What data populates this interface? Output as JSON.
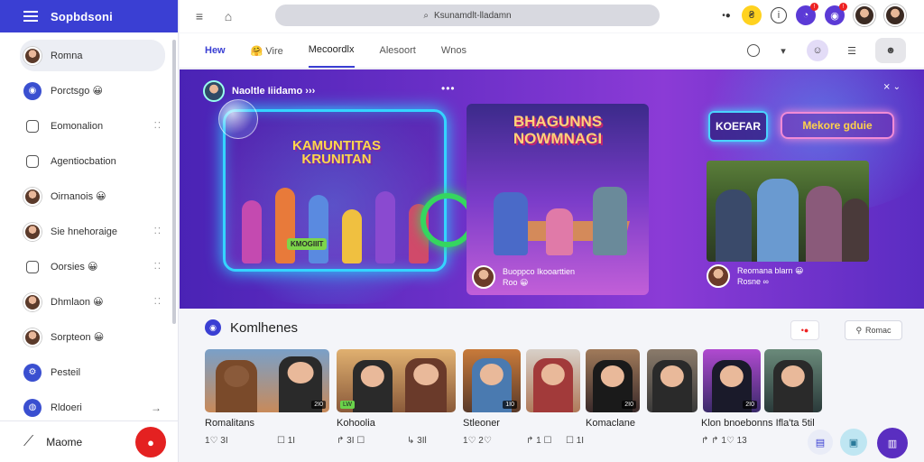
{
  "app": {
    "title": "Sopbdsoni",
    "brand_color": "#3a3fd3"
  },
  "sidebar": {
    "items": [
      {
        "label": "Romna",
        "icon": "avatar",
        "active": true
      },
      {
        "label": "Porctsgo 😀",
        "icon": "app-icon"
      },
      {
        "label": "Eomonalion",
        "icon": "list-icon",
        "more": "⁚⁚"
      },
      {
        "label": "Agentiocbation",
        "icon": "chat-icon"
      },
      {
        "label": "Oirnanois 😀",
        "icon": "avatar"
      },
      {
        "label": "Sie hnehoraige",
        "icon": "avatar",
        "more": "⁚⁚"
      },
      {
        "label": "Oorsies 😀",
        "icon": "doc-icon",
        "more": "⁚⁚"
      },
      {
        "label": "Dhmlaon 😀",
        "icon": "avatar",
        "more": "⁚⁚"
      },
      {
        "label": "Sorpteon 😀",
        "icon": "avatar"
      },
      {
        "label": "Pesteil",
        "icon": "settings-icon"
      },
      {
        "label": "Rldoeri",
        "icon": "globe-icon",
        "arrow": "→"
      }
    ],
    "footer": {
      "label": "Maome",
      "record_icon": "record-icon"
    }
  },
  "topbar": {
    "search_placeholder": "Ksunamdlt-lladamn",
    "icons": [
      "menu-icon",
      "home-icon",
      "dots-icon",
      "yellow-badge-icon",
      "info-icon",
      "notifications-icon",
      "alert-icon"
    ]
  },
  "tabs": {
    "items": [
      {
        "label": "Hew",
        "brand": true
      },
      {
        "label": "🤗 Vire"
      },
      {
        "label": "Mecoordlx",
        "active": true
      },
      {
        "label": "Alesoort"
      },
      {
        "label": "Wnos"
      }
    ]
  },
  "hero": {
    "channel": "Naoltle Iiidamo ›››",
    "more": "•••",
    "controls": "⨯ ⌄",
    "left_title": "KAMUNTITAS\nKRUNITAN",
    "left_tag": "KMOGIIIT",
    "center_title": "BHAGUNNS\nNOWMNAGI",
    "center_author": "Buoppco Ikooarttien",
    "center_sub": "Roo 😀",
    "right_logo": "KOEFAR",
    "right_button": "Mekore gduie",
    "right_author": "Reomana blarn 😀",
    "right_sub": "Rosne ∞"
  },
  "section": {
    "title": "Komlhenes",
    "pill": "•●",
    "button": "Romac"
  },
  "cards": [
    {
      "title": "Romalitans",
      "meta": "1♡ 3I",
      "duration": "2I0"
    },
    {
      "title": "Kohoolia",
      "meta": "↱ 3I ☐",
      "badge": "LW"
    },
    {
      "title": "Stleoner",
      "meta": "1♡ 2♡",
      "duration": "1I0"
    },
    {
      "title": "Komaclane",
      "meta": "↱ 1 ☐",
      "duration": "2I0"
    },
    {
      "title": "Klon bnoebonns Ifla'ta 5til",
      "meta": "↱ ↱ 1♡ 13",
      "duration": "2I0"
    }
  ],
  "card_meta_extra": [
    "☐ 1I",
    "↳ 3Il",
    "☐ 1I",
    "☐ 1I",
    "☐ 1I"
  ],
  "fabs": [
    "chat-icon",
    "camera-icon",
    "library-icon"
  ]
}
